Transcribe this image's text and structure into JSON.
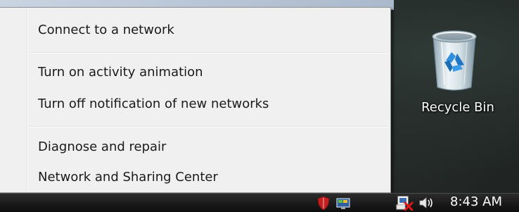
{
  "context_menu": {
    "items": [
      {
        "label": "Connect to a network"
      },
      {
        "label": "Turn on activity animation"
      },
      {
        "label": "Turn off notification of new networks"
      },
      {
        "label": "Diagnose and repair"
      },
      {
        "label": "Network and Sharing Center"
      }
    ]
  },
  "desktop": {
    "recycle_bin_label": "Recycle Bin"
  },
  "taskbar": {
    "clock": "8:43 AM",
    "tray_icons": [
      "security-shield-icon",
      "monitor-icon",
      "network-disconnected-icon",
      "volume-icon"
    ]
  },
  "colors": {
    "menu_background": "#f0f0f0",
    "menu_text": "#1a1a1a",
    "taskbar": "#111111",
    "network_error_red": "#e01818"
  }
}
